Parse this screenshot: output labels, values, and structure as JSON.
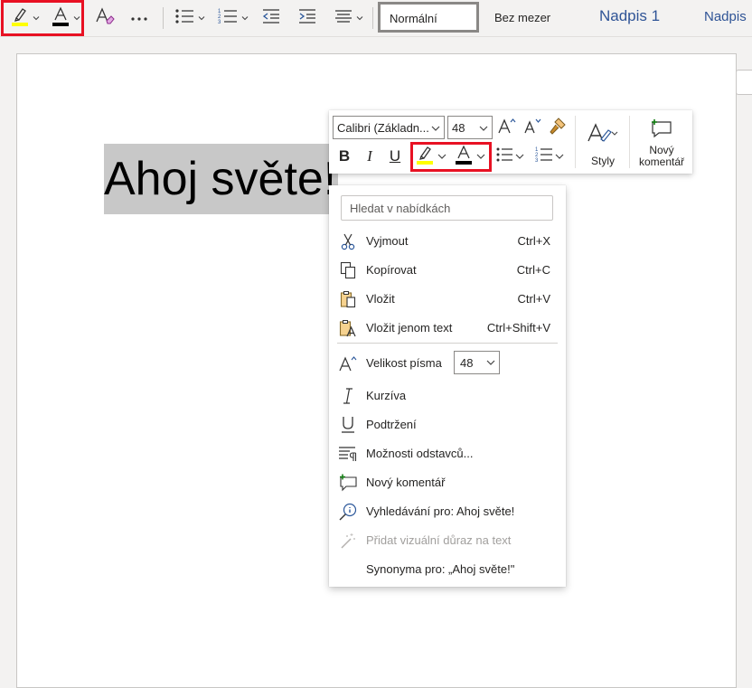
{
  "ribbon": {
    "highlight_icon": "highlighter-icon",
    "font_color_icon": "font-color-icon",
    "clear_format_icon": "clear-formatting-icon",
    "more_icon": "more-options-icon",
    "bullets_icon": "bullet-list-icon",
    "numbering_icon": "numbered-list-icon",
    "decrease_indent_icon": "decrease-indent-icon",
    "increase_indent_icon": "increase-indent-icon",
    "align_icon": "align-icon",
    "styles": {
      "normal": "Normální",
      "no_spacing": "Bez mezer",
      "heading1": "Nadpis 1",
      "heading2": "Nadpis"
    },
    "colors": {
      "highlight": "#ffff00",
      "font_color": "#000000",
      "red_outline": "#e81123"
    }
  },
  "document": {
    "text": "Ahoj světe!"
  },
  "mini_toolbar": {
    "font_name": "Calibri (Základn...",
    "font_size": "48",
    "bold": "B",
    "italic": "I",
    "underline": "U",
    "styles_label": "Styly",
    "comment_label_line1": "Nový",
    "comment_label_line2": "komentář"
  },
  "context_menu": {
    "search_placeholder": "Hledat v nabídkách",
    "items": [
      {
        "label": "Vyjmout",
        "shortcut": "Ctrl+X",
        "icon": "scissors-icon"
      },
      {
        "label": "Kopírovat",
        "shortcut": "Ctrl+C",
        "icon": "copy-icon"
      },
      {
        "label": "Vložit",
        "shortcut": "Ctrl+V",
        "icon": "paste-icon"
      },
      {
        "label": "Vložit jenom text",
        "shortcut": "Ctrl+Shift+V",
        "icon": "paste-text-icon"
      },
      {
        "label": "Velikost písma",
        "shortcut": "",
        "icon": "font-size-icon"
      },
      {
        "label": "Kurzíva",
        "shortcut": "",
        "icon": "italic-icon"
      },
      {
        "label": "Podtržení",
        "shortcut": "",
        "icon": "underline-icon"
      },
      {
        "label": "Možnosti odstavců...",
        "shortcut": "",
        "icon": "paragraph-options-icon"
      },
      {
        "label": "Nový komentář",
        "shortcut": "",
        "icon": "new-comment-icon"
      },
      {
        "label": "Vyhledávání pro: Ahoj světe!",
        "shortcut": "",
        "icon": "smart-lookup-icon"
      },
      {
        "label": "Přidat vizuální důraz na text",
        "shortcut": "",
        "icon": "magic-wand-icon"
      },
      {
        "label": "Synonyma pro: „Ahoj světe!\"",
        "shortcut": "",
        "icon": ""
      }
    ],
    "font_size_value": "48"
  }
}
